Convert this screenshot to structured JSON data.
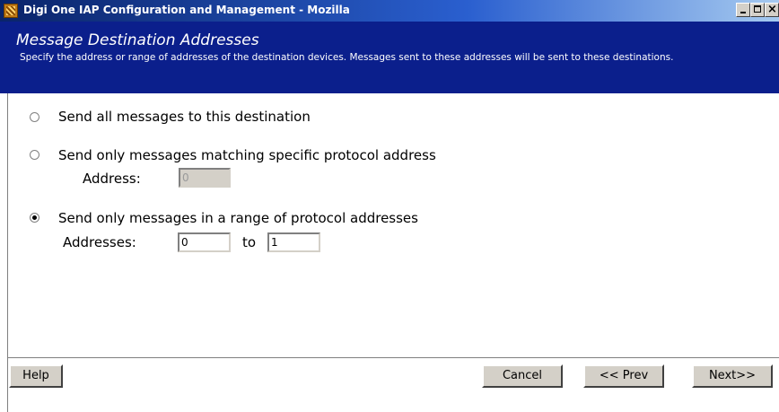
{
  "window": {
    "title": "Digi One IAP Configuration and Management - Mozilla"
  },
  "header": {
    "title": "Message Destination Addresses",
    "description": "Specify the address or range of addresses of the destination devices. Messages sent to these addresses will be sent to these destinations."
  },
  "options": {
    "all": {
      "label": "Send all messages to this destination",
      "selected": false
    },
    "specific": {
      "label": "Send only messages matching specific protocol address",
      "selected": false,
      "address_label": "Address:",
      "address_value": "0"
    },
    "range": {
      "label": "Send only messages in a range of protocol addresses",
      "selected": true,
      "addresses_label": "Addresses:",
      "from_value": "0",
      "to_label": "to",
      "to_value": "1"
    }
  },
  "footer": {
    "help": "Help",
    "cancel": "Cancel",
    "prev": "<< Prev",
    "next": "Next>>"
  }
}
